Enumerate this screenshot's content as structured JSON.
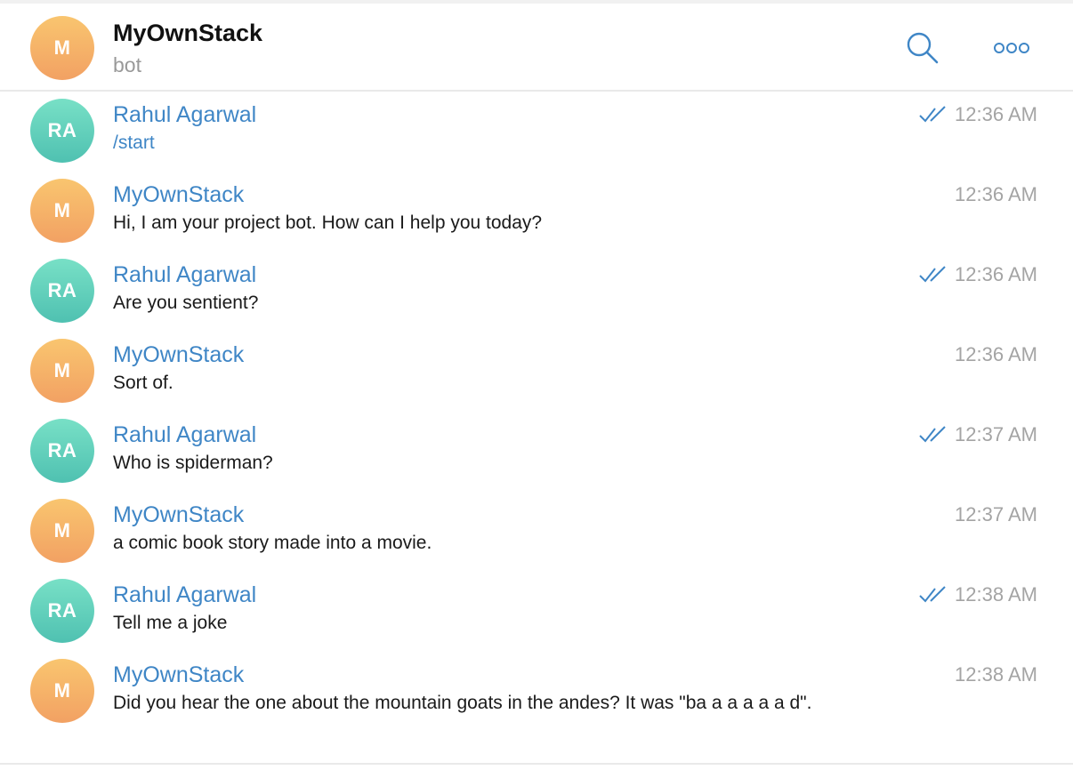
{
  "header": {
    "avatar_initials": "M",
    "title": "MyOwnStack",
    "subtitle": "bot",
    "search_icon": "search-icon",
    "more_icon": "more-options-icon"
  },
  "colors": {
    "accent": "#3f86c6",
    "bot_avatar": "#f5b066",
    "user_avatar": "#5fcfb8",
    "time": "#a4a4a4"
  },
  "messages": [
    {
      "initials": "RA",
      "sender": "Rahul Agarwal",
      "text": "/start",
      "time": "12:36 AM",
      "read": true,
      "is_command": true
    },
    {
      "initials": "M",
      "sender": "MyOwnStack",
      "text": "Hi, I am your project bot. How can I help you today?",
      "time": "12:36 AM",
      "read": false
    },
    {
      "initials": "RA",
      "sender": "Rahul Agarwal",
      "text": "Are you sentient?",
      "time": "12:36 AM",
      "read": true
    },
    {
      "initials": "M",
      "sender": "MyOwnStack",
      "text": "Sort of.",
      "time": "12:36 AM",
      "read": false
    },
    {
      "initials": "RA",
      "sender": "Rahul Agarwal",
      "text": "Who is spiderman?",
      "time": "12:37 AM",
      "read": true
    },
    {
      "initials": "M",
      "sender": "MyOwnStack",
      "text": "a comic book story made into a movie.",
      "time": "12:37 AM",
      "read": false
    },
    {
      "initials": "RA",
      "sender": "Rahul Agarwal",
      "text": "Tell me a joke",
      "time": "12:38 AM",
      "read": true
    },
    {
      "initials": "M",
      "sender": "MyOwnStack",
      "text": "Did you hear the one about the mountain goats in the andes? It was \"ba a a a a a d\".",
      "time": "12:38 AM",
      "read": false
    }
  ]
}
